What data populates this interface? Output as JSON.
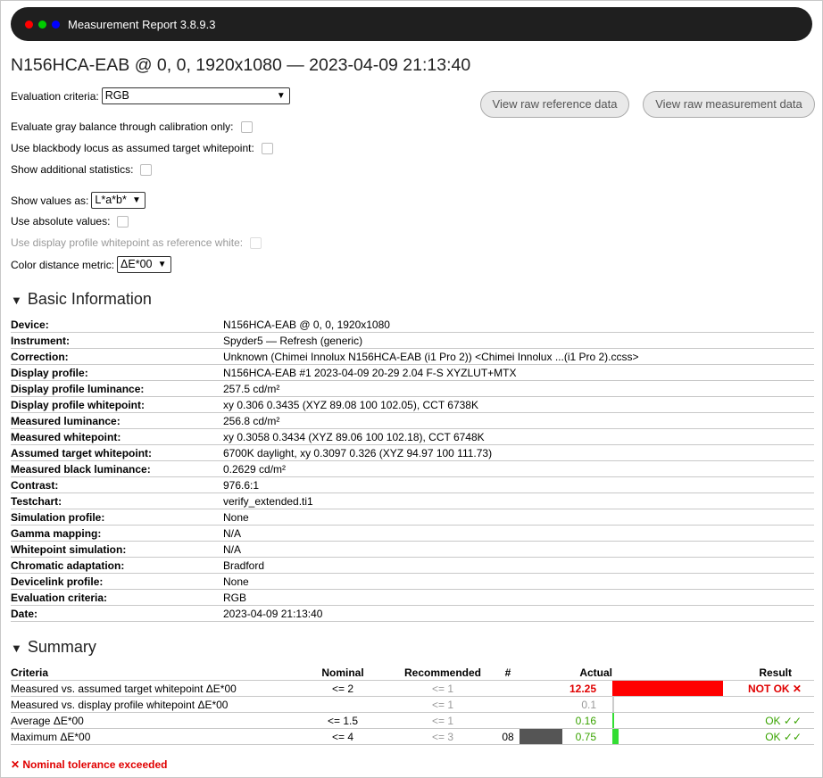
{
  "window": {
    "title": "Measurement Report 3.8.9.3",
    "dots": [
      "#ff0000",
      "#00cc00",
      "#0000ff"
    ]
  },
  "heading": "N156HCA-EAB @ 0, 0, 1920x1080 — 2023-04-09 21:13:40",
  "options": {
    "criteria_label": "Evaluation criteria:",
    "criteria_value": "RGB",
    "gray_balance": "Evaluate gray balance through calibration only:",
    "blackbody": "Use blackbody locus as assumed target whitepoint:",
    "additional_stats": "Show additional statistics:",
    "show_values_label": "Show values as:",
    "show_values_value": "L*a*b*",
    "absolute": "Use absolute values:",
    "profile_whitepoint": "Use display profile whitepoint as reference white:",
    "metric_label": "Color distance metric:",
    "metric_value": "ΔE*00"
  },
  "buttons": {
    "raw_reference": "View raw reference data",
    "raw_measurement": "View raw measurement data"
  },
  "basic_info": {
    "title": "Basic Information",
    "rows": [
      {
        "k": "Device:",
        "v": "N156HCA-EAB @ 0, 0, 1920x1080"
      },
      {
        "k": "Instrument:",
        "v": "Spyder5 — Refresh (generic)"
      },
      {
        "k": "Correction:",
        "v": "Unknown (Chimei Innolux N156HCA-EAB (i1 Pro 2)) <Chimei Innolux ...(i1 Pro 2).ccss>"
      },
      {
        "k": "Display profile:",
        "v": "N156HCA-EAB #1 2023-04-09 20-29 2.04 F-S XYZLUT+MTX"
      },
      {
        "k": "Display profile luminance:",
        "v": "257.5 cd/m²"
      },
      {
        "k": "Display profile whitepoint:",
        "v": "xy 0.306 0.3435 (XYZ 89.08 100 102.05), CCT 6738K"
      },
      {
        "k": "Measured luminance:",
        "v": "256.8 cd/m²"
      },
      {
        "k": "Measured whitepoint:",
        "v": "xy 0.3058 0.3434 (XYZ 89.06 100 102.18), CCT 6748K"
      },
      {
        "k": "Assumed target whitepoint:",
        "v": "6700K daylight, xy 0.3097 0.326 (XYZ 94.97 100 111.73)"
      },
      {
        "k": "Measured black luminance:",
        "v": "0.2629 cd/m²"
      },
      {
        "k": "Contrast:",
        "v": "976.6:1"
      },
      {
        "k": "Testchart:",
        "v": "verify_extended.ti1"
      },
      {
        "k": "Simulation profile:",
        "v": "None"
      },
      {
        "k": "Gamma mapping:",
        "v": "N/A"
      },
      {
        "k": "Whitepoint simulation:",
        "v": "N/A"
      },
      {
        "k": "Chromatic adaptation:",
        "v": "Bradford"
      },
      {
        "k": "Devicelink profile:",
        "v": "None"
      },
      {
        "k": "Evaluation criteria:",
        "v": "RGB"
      },
      {
        "k": "Date:",
        "v": "2023-04-09 21:13:40"
      }
    ]
  },
  "summary": {
    "title": "Summary",
    "headers": {
      "criteria": "Criteria",
      "nominal": "Nominal",
      "recommended": "Recommended",
      "num": "#",
      "actual": "Actual",
      "result": "Result"
    },
    "rows": [
      {
        "criteria": "Measured vs. assumed target whitepoint ΔE*00",
        "nominal": "<= 2",
        "recommended": "<= 1",
        "num": "",
        "actual": "12.25",
        "bar_fraction": 1.0,
        "bar_color": "#ff0000",
        "result": "NOT OK ✕",
        "status": "bad"
      },
      {
        "criteria": "Measured vs. display profile whitepoint ΔE*00",
        "nominal": "",
        "recommended": "<= 1",
        "num": "",
        "actual": "0.1",
        "bar_fraction": 0.02,
        "bar_color": "#cccccc",
        "result": "",
        "status": "neutral"
      },
      {
        "criteria": "Average ΔE*00",
        "nominal": "<= 1.5",
        "recommended": "<= 1",
        "num": "",
        "actual": "0.16",
        "bar_fraction": 0.02,
        "bar_color": "#33dd33",
        "result": "OK ✓✓",
        "status": "ok"
      },
      {
        "criteria": "Maximum ΔE*00",
        "nominal": "<= 4",
        "recommended": "<= 3",
        "num": "08",
        "swatch": "#555555",
        "actual": "0.75",
        "bar_fraction": 0.06,
        "bar_color": "#33dd33",
        "result": "OK ✓✓",
        "status": "ok"
      }
    ]
  },
  "footer": "✕ Nominal tolerance exceeded"
}
